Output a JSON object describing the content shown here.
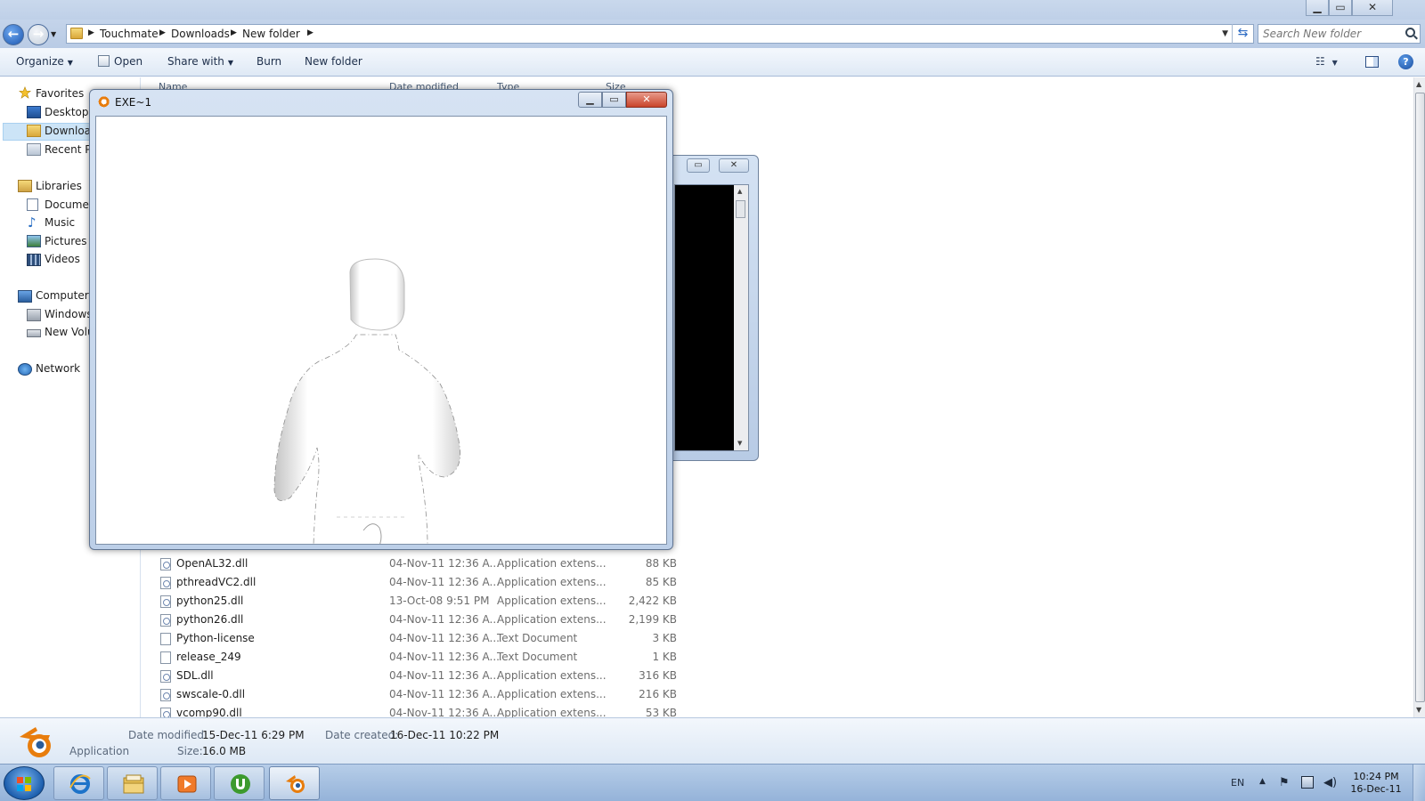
{
  "explorer": {
    "caption_buttons": {
      "minimize": "▁",
      "maximize": "▭",
      "close": "✕"
    },
    "breadcrumbs": [
      "Touchmate",
      "Downloads",
      "New folder"
    ],
    "search_placeholder": "Search New folder",
    "toolbar": {
      "organize": "Organize",
      "open": "Open",
      "share_with": "Share with",
      "burn": "Burn",
      "new_folder": "New folder",
      "help": "?"
    },
    "nav": {
      "favorites": "Favorites",
      "desktop": "Desktop",
      "downloads": "Downloads",
      "recent_places": "Recent Places",
      "libraries": "Libraries",
      "documents": "Documents",
      "music": "Music",
      "pictures": "Pictures",
      "videos": "Videos",
      "computer": "Computer",
      "windows": "Windows (C:)",
      "new_volume": "New Volume (D:)",
      "network": "Network"
    },
    "columns": {
      "name": "Name",
      "date_modified": "Date modified",
      "type": "Type",
      "size": "Size"
    },
    "files": [
      {
        "name": "OpenAL32.dll",
        "date": "04-Nov-11 12:36 A...",
        "type": "Application extens...",
        "size": "88 KB",
        "kind": "dll"
      },
      {
        "name": "pthreadVC2.dll",
        "date": "04-Nov-11 12:36 A...",
        "type": "Application extens...",
        "size": "85 KB",
        "kind": "dll"
      },
      {
        "name": "python25.dll",
        "date": "13-Oct-08 9:51 PM",
        "type": "Application extens...",
        "size": "2,422 KB",
        "kind": "dll"
      },
      {
        "name": "python26.dll",
        "date": "04-Nov-11 12:36 A...",
        "type": "Application extens...",
        "size": "2,199 KB",
        "kind": "dll"
      },
      {
        "name": "Python-license",
        "date": "04-Nov-11 12:36 A...",
        "type": "Text Document",
        "size": "3 KB",
        "kind": "txt"
      },
      {
        "name": "release_249",
        "date": "04-Nov-11 12:36 A...",
        "type": "Text Document",
        "size": "1 KB",
        "kind": "txt"
      },
      {
        "name": "SDL.dll",
        "date": "04-Nov-11 12:36 A...",
        "type": "Application extens...",
        "size": "316 KB",
        "kind": "dll"
      },
      {
        "name": "swscale-0.dll",
        "date": "04-Nov-11 12:36 A...",
        "type": "Application extens...",
        "size": "216 KB",
        "kind": "dll"
      },
      {
        "name": "vcomp90.dll",
        "date": "04-Nov-11 12:36 A...",
        "type": "Application extens...",
        "size": "53 KB",
        "kind": "dll"
      }
    ],
    "details": {
      "file_type": "Application",
      "date_modified_label": "Date modified:",
      "date_modified": "15-Dec-11 6:29 PM",
      "date_created_label": "Date created:",
      "date_created": "16-Dec-11 10:22 PM",
      "size_label": "Size:",
      "size": "16.0 MB"
    }
  },
  "blender_window": {
    "title": "EXE~1",
    "minimize": "▁",
    "maximize": "▭",
    "close": "✕"
  },
  "console_window": {
    "maximize": "▭",
    "close": "✕"
  },
  "taskbar": {
    "language": "EN",
    "time": "10:24 PM",
    "date": "16-Dec-11",
    "items": [
      "internet-explorer",
      "windows-explorer",
      "media-player",
      "utorrent",
      "blender"
    ]
  },
  "colors": {
    "accent_blue": "#1c56b0",
    "blender_orange": "#e87d0d",
    "utorrent_green": "#3c9a2e"
  }
}
